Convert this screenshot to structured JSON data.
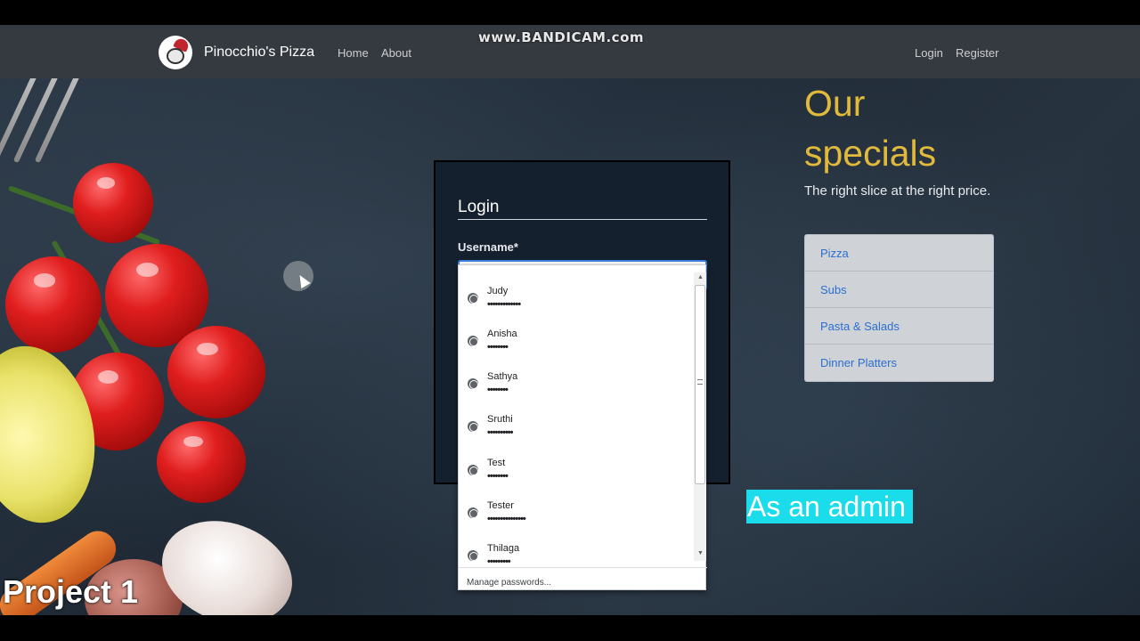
{
  "watermark": "www.BANDICAM.com",
  "navbar": {
    "brand": "Pinocchio's Pizza",
    "links": {
      "home": "Home",
      "about": "About",
      "login": "Login",
      "register": "Register"
    }
  },
  "login": {
    "title": "Login",
    "username_label": "Username*",
    "username_value": ""
  },
  "autofill": {
    "entries": [
      {
        "name": "Judy",
        "password": "•••••••••••••"
      },
      {
        "name": "Anisha",
        "password": "••••••••"
      },
      {
        "name": "Sathya",
        "password": "••••••••"
      },
      {
        "name": "Sruthi",
        "password": "••••••••••"
      },
      {
        "name": "Test",
        "password": "••••••••"
      },
      {
        "name": "Tester",
        "password": "•••••••••••••••"
      },
      {
        "name": "Thilaga",
        "password": "•••••••••"
      }
    ],
    "manage": "Manage passwords..."
  },
  "specials": {
    "title": "Our specials",
    "subtitle": "The right slice at the right price.",
    "menu": [
      "Pizza",
      "Subs",
      "Pasta & Salads",
      "Dinner Platters"
    ]
  },
  "overlay": {
    "caption": "As an admin",
    "project": "Project 1"
  },
  "colors": {
    "navbar": "#343a40",
    "accent_gold": "#e1b93b",
    "link_blue": "#2b6fd1",
    "caption_bg": "#1bdcea",
    "input_focus": "#3b7ddd"
  }
}
